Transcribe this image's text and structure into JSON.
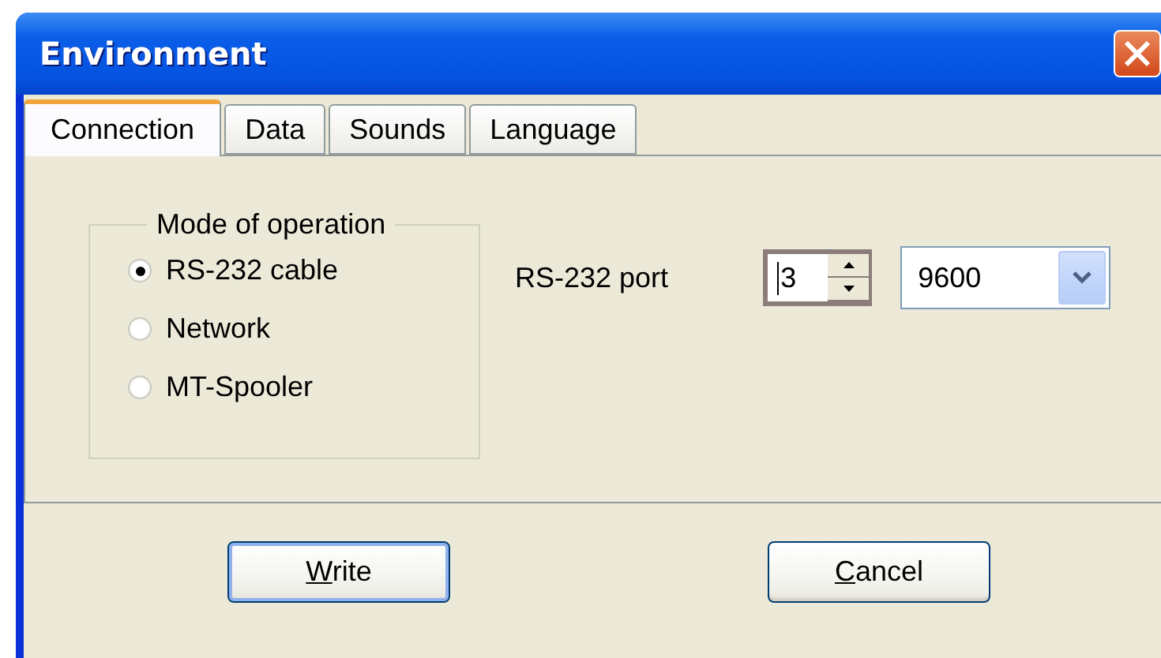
{
  "window": {
    "title": "Environment"
  },
  "tabs": [
    {
      "label": "Connection",
      "selected": true
    },
    {
      "label": "Data",
      "selected": false
    },
    {
      "label": "Sounds",
      "selected": false
    },
    {
      "label": "Language",
      "selected": false
    }
  ],
  "mode_group": {
    "title": "Mode of operation",
    "options": [
      {
        "label": "RS-232 cable",
        "selected": true
      },
      {
        "label": "Network",
        "selected": false
      },
      {
        "label": "MT-Spooler",
        "selected": false
      }
    ]
  },
  "port": {
    "label": "RS-232 port",
    "number": "3",
    "baud_rate": "9600"
  },
  "buttons": [
    {
      "label": "Write",
      "default": true
    },
    {
      "label": "Cancel",
      "default": false
    }
  ]
}
